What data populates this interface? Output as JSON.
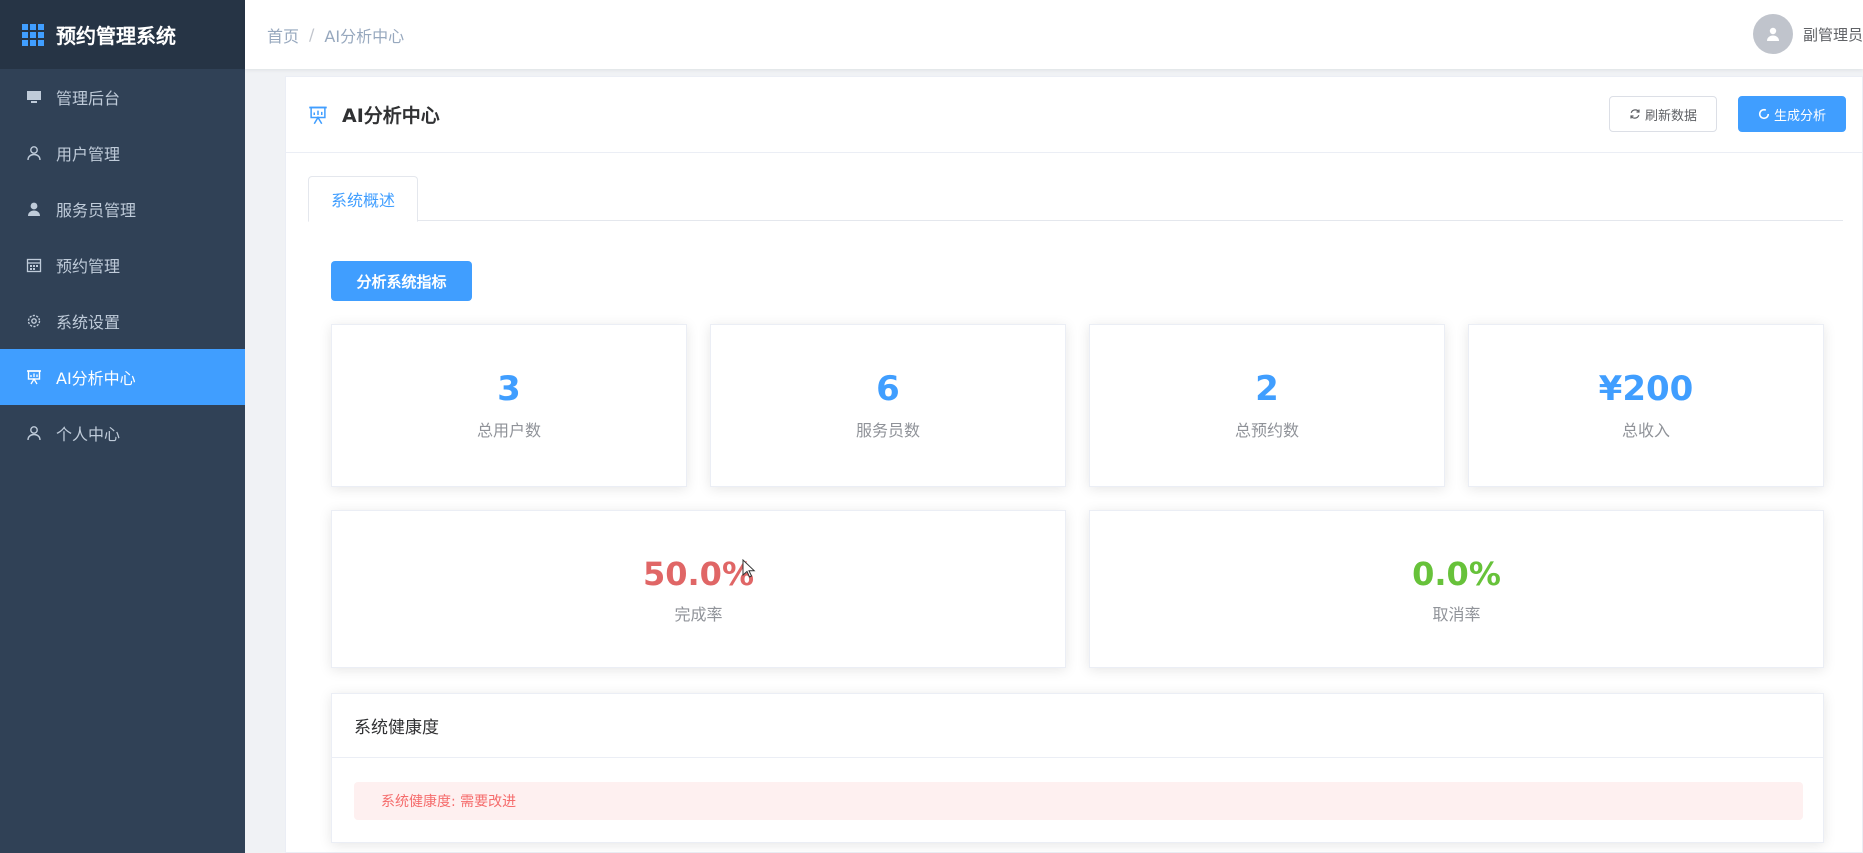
{
  "sidebar": {
    "title": "预约管理系统",
    "items": [
      {
        "label": "管理后台",
        "icon": "monitor-icon"
      },
      {
        "label": "用户管理",
        "icon": "user-icon"
      },
      {
        "label": "服务员管理",
        "icon": "user-solid-icon"
      },
      {
        "label": "预约管理",
        "icon": "calendar-icon"
      },
      {
        "label": "系统设置",
        "icon": "gear-icon"
      },
      {
        "label": "AI分析中心",
        "icon": "presentation-icon",
        "active": true
      },
      {
        "label": "个人中心",
        "icon": "user-icon"
      }
    ]
  },
  "header": {
    "breadcrumb_home": "首页",
    "breadcrumb_sep": "/",
    "breadcrumb_current": "AI分析中心",
    "user_name": "副管理员"
  },
  "main": {
    "title": "AI分析中心",
    "refresh_label": "刷新数据",
    "generate_label": "生成分析",
    "tab_label": "系统概述",
    "analyze_label": "分析系统指标",
    "stats": [
      {
        "value": "3",
        "label": "总用户数"
      },
      {
        "value": "6",
        "label": "服务员数"
      },
      {
        "value": "2",
        "label": "总预约数"
      },
      {
        "value": "¥200",
        "label": "总收入"
      }
    ],
    "rates": [
      {
        "value": "50.0%",
        "label": "完成率",
        "color": "#e06666"
      },
      {
        "value": "0.0%",
        "label": "取消率",
        "color": "#67c23a"
      }
    ],
    "health_title": "系统健康度",
    "health_alert": "系统健康度: 需要改进"
  },
  "colors": {
    "sidebar_bg": "#304156",
    "accent": "#409eff",
    "danger": "#f56c6c",
    "success": "#67c23a"
  }
}
